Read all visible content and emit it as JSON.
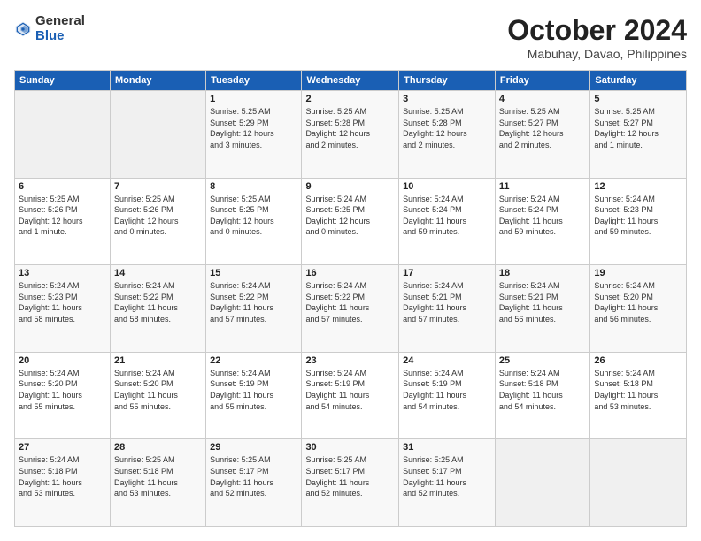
{
  "header": {
    "logo_general": "General",
    "logo_blue": "Blue",
    "title": "October 2024",
    "location": "Mabuhay, Davao, Philippines"
  },
  "days_of_week": [
    "Sunday",
    "Monday",
    "Tuesday",
    "Wednesday",
    "Thursday",
    "Friday",
    "Saturday"
  ],
  "weeks": [
    [
      {
        "day": "",
        "info": ""
      },
      {
        "day": "",
        "info": ""
      },
      {
        "day": "1",
        "info": "Sunrise: 5:25 AM\nSunset: 5:29 PM\nDaylight: 12 hours\nand 3 minutes."
      },
      {
        "day": "2",
        "info": "Sunrise: 5:25 AM\nSunset: 5:28 PM\nDaylight: 12 hours\nand 2 minutes."
      },
      {
        "day": "3",
        "info": "Sunrise: 5:25 AM\nSunset: 5:28 PM\nDaylight: 12 hours\nand 2 minutes."
      },
      {
        "day": "4",
        "info": "Sunrise: 5:25 AM\nSunset: 5:27 PM\nDaylight: 12 hours\nand 2 minutes."
      },
      {
        "day": "5",
        "info": "Sunrise: 5:25 AM\nSunset: 5:27 PM\nDaylight: 12 hours\nand 1 minute."
      }
    ],
    [
      {
        "day": "6",
        "info": "Sunrise: 5:25 AM\nSunset: 5:26 PM\nDaylight: 12 hours\nand 1 minute."
      },
      {
        "day": "7",
        "info": "Sunrise: 5:25 AM\nSunset: 5:26 PM\nDaylight: 12 hours\nand 0 minutes."
      },
      {
        "day": "8",
        "info": "Sunrise: 5:25 AM\nSunset: 5:25 PM\nDaylight: 12 hours\nand 0 minutes."
      },
      {
        "day": "9",
        "info": "Sunrise: 5:24 AM\nSunset: 5:25 PM\nDaylight: 12 hours\nand 0 minutes."
      },
      {
        "day": "10",
        "info": "Sunrise: 5:24 AM\nSunset: 5:24 PM\nDaylight: 11 hours\nand 59 minutes."
      },
      {
        "day": "11",
        "info": "Sunrise: 5:24 AM\nSunset: 5:24 PM\nDaylight: 11 hours\nand 59 minutes."
      },
      {
        "day": "12",
        "info": "Sunrise: 5:24 AM\nSunset: 5:23 PM\nDaylight: 11 hours\nand 59 minutes."
      }
    ],
    [
      {
        "day": "13",
        "info": "Sunrise: 5:24 AM\nSunset: 5:23 PM\nDaylight: 11 hours\nand 58 minutes."
      },
      {
        "day": "14",
        "info": "Sunrise: 5:24 AM\nSunset: 5:22 PM\nDaylight: 11 hours\nand 58 minutes."
      },
      {
        "day": "15",
        "info": "Sunrise: 5:24 AM\nSunset: 5:22 PM\nDaylight: 11 hours\nand 57 minutes."
      },
      {
        "day": "16",
        "info": "Sunrise: 5:24 AM\nSunset: 5:22 PM\nDaylight: 11 hours\nand 57 minutes."
      },
      {
        "day": "17",
        "info": "Sunrise: 5:24 AM\nSunset: 5:21 PM\nDaylight: 11 hours\nand 57 minutes."
      },
      {
        "day": "18",
        "info": "Sunrise: 5:24 AM\nSunset: 5:21 PM\nDaylight: 11 hours\nand 56 minutes."
      },
      {
        "day": "19",
        "info": "Sunrise: 5:24 AM\nSunset: 5:20 PM\nDaylight: 11 hours\nand 56 minutes."
      }
    ],
    [
      {
        "day": "20",
        "info": "Sunrise: 5:24 AM\nSunset: 5:20 PM\nDaylight: 11 hours\nand 55 minutes."
      },
      {
        "day": "21",
        "info": "Sunrise: 5:24 AM\nSunset: 5:20 PM\nDaylight: 11 hours\nand 55 minutes."
      },
      {
        "day": "22",
        "info": "Sunrise: 5:24 AM\nSunset: 5:19 PM\nDaylight: 11 hours\nand 55 minutes."
      },
      {
        "day": "23",
        "info": "Sunrise: 5:24 AM\nSunset: 5:19 PM\nDaylight: 11 hours\nand 54 minutes."
      },
      {
        "day": "24",
        "info": "Sunrise: 5:24 AM\nSunset: 5:19 PM\nDaylight: 11 hours\nand 54 minutes."
      },
      {
        "day": "25",
        "info": "Sunrise: 5:24 AM\nSunset: 5:18 PM\nDaylight: 11 hours\nand 54 minutes."
      },
      {
        "day": "26",
        "info": "Sunrise: 5:24 AM\nSunset: 5:18 PM\nDaylight: 11 hours\nand 53 minutes."
      }
    ],
    [
      {
        "day": "27",
        "info": "Sunrise: 5:24 AM\nSunset: 5:18 PM\nDaylight: 11 hours\nand 53 minutes."
      },
      {
        "day": "28",
        "info": "Sunrise: 5:25 AM\nSunset: 5:18 PM\nDaylight: 11 hours\nand 53 minutes."
      },
      {
        "day": "29",
        "info": "Sunrise: 5:25 AM\nSunset: 5:17 PM\nDaylight: 11 hours\nand 52 minutes."
      },
      {
        "day": "30",
        "info": "Sunrise: 5:25 AM\nSunset: 5:17 PM\nDaylight: 11 hours\nand 52 minutes."
      },
      {
        "day": "31",
        "info": "Sunrise: 5:25 AM\nSunset: 5:17 PM\nDaylight: 11 hours\nand 52 minutes."
      },
      {
        "day": "",
        "info": ""
      },
      {
        "day": "",
        "info": ""
      }
    ]
  ]
}
